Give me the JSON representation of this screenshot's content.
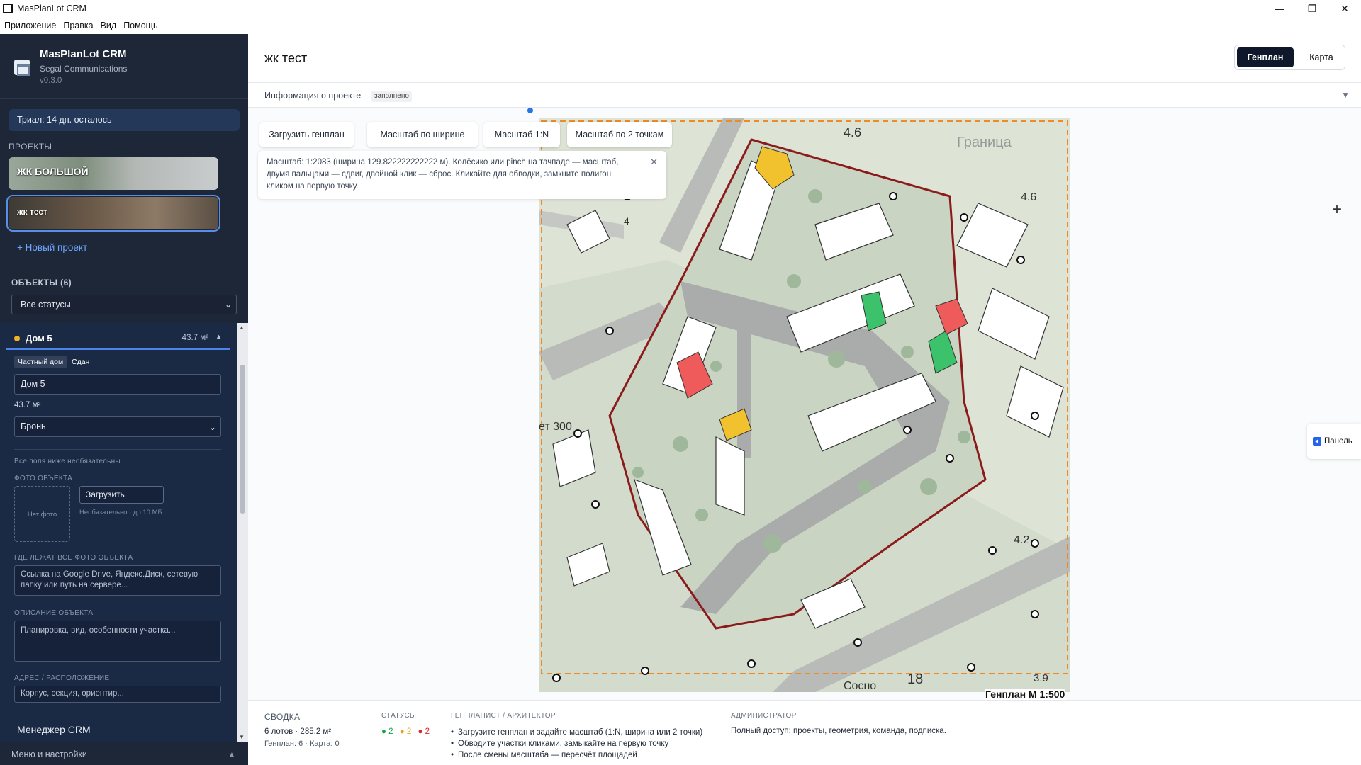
{
  "window": {
    "title": "MasPlanLot CRM",
    "minimize": "—",
    "maximize": "❐",
    "close": "✕"
  },
  "menu": [
    "Приложение",
    "Правка",
    "Вид",
    "Помощь"
  ],
  "sidebar": {
    "app_name": "MasPlanLot CRM",
    "company": "Segal Communications",
    "version": "v0.3.0",
    "trial": "Триал: 14 дн. осталось",
    "projects_label": "ПРОЕКТЫ",
    "projects": [
      {
        "name": "ЖК БОЛЬШОЙ"
      },
      {
        "name": "жк тест"
      }
    ],
    "new_project": "+ Новый проект",
    "objects_label": "ОБЪЕКТЫ (6)",
    "status_filter": "Все статусы",
    "object": {
      "name": "Дом 5",
      "area": "43.7 м²",
      "tag_type": "Частный дом",
      "tag_state": "Сдан",
      "name_value": "Дом 5",
      "area_value": "43.7 м²",
      "status_value": "Бронь",
      "optional_note": "Все поля ниже необязательны",
      "photo_label": "ФОТО ОБЪЕКТА",
      "no_photo": "Нет фото",
      "upload": "Загрузить",
      "upload_hint": "Необязательно · до 10 МБ",
      "photos_location_label": "ГДЕ ЛЕЖАТ ВСЕ ФОТО ОБЪЕКТА",
      "photos_location_placeholder": "Ссылка на Google Drive, Яндекс.Диск, сетевую папку или путь на сервере...",
      "description_label": "ОПИСАНИЕ ОБЪЕКТА",
      "description_placeholder": "Планировка, вид, особенности участка...",
      "address_label": "АДРЕС / РАСПОЛОЖЕНИЕ",
      "address_placeholder": "Корпус, секция, ориентир..."
    },
    "crm_manager": "Менеджер CRM",
    "menu_settings": "Меню и настройки"
  },
  "main": {
    "title": "жк тест",
    "view_genplan": "Генплан",
    "view_map": "Карта",
    "info_title": "Информация о проекте",
    "info_badge": "заполнено",
    "toolbar": {
      "upload": "Загрузить генплан",
      "scale_width": "Масштаб по ширине",
      "scale_1n": "Масштаб 1:N",
      "scale_2pt": "Масштаб по 2 точкам"
    },
    "hint": "Масштаб: 1:2083 (ширина 129.822222222222 м). Колёсико или pinch на тачпаде — масштаб, двумя пальцами — сдвиг, двойной клик — сброс. Кликайте для обводки, замкните полигон кликом на первую точку.",
    "panel_button": "Панель",
    "plan_caption": "Генплан М 1:500",
    "plan_labels": {
      "a": "4.6",
      "b": "4.6",
      "c": "4.2",
      "d": "3.9",
      "e": "18",
      "f": "4",
      "g": "Граница",
      "h": "Сосно",
      "i": "ет 300",
      "j": "4.2"
    },
    "colors": {
      "sold": "#f2c12e",
      "reserved": "#f2c12e",
      "free": "#3cc26a",
      "busy": "#ef5b5b",
      "boundary": "#8b1a1a",
      "dash": "#f08a24"
    }
  },
  "summary": {
    "title": "СВОДКА",
    "lots": "6 лотов · 285.2 м²",
    "counts": "Генплан: 6 · Карта: 0",
    "statuses_label": "СТАТУСЫ",
    "statuses": [
      {
        "count": "● 2",
        "color": "#16a34a"
      },
      {
        "count": "● 2",
        "color": "#e8a21a"
      },
      {
        "count": "● 2",
        "color": "#dc2626"
      }
    ],
    "architect_label": "ГЕНПЛАНИСТ / АРХИТЕКТОР",
    "architect_items": [
      "Загрузите генплан и задайте масштаб (1:N, ширина или 2 точки)",
      "Обводите участки кликами, замыкайте на первую точку",
      "После смены масштаба — пересчёт площадей"
    ],
    "admin_label": "АДМИНИСТРАТОР",
    "admin_text": "Полный доступ: проекты, геометрия, команда, подписка."
  }
}
